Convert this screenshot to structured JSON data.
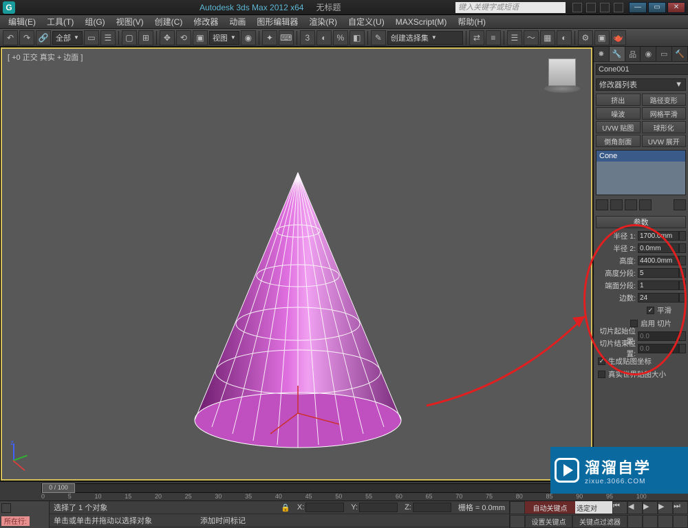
{
  "titlebar": {
    "app": "Autodesk 3ds Max 2012 x64",
    "doc": "无标题",
    "search_placeholder": "键入关键字或短语"
  },
  "menus": [
    "编辑(E)",
    "工具(T)",
    "组(G)",
    "视图(V)",
    "创建(C)",
    "修改器",
    "动画",
    "图形编辑器",
    "渲染(R)",
    "自定义(U)",
    "MAXScript(M)",
    "帮助(H)"
  ],
  "toolbar": {
    "set_dropdown": "全部",
    "view_dropdown": "视图",
    "selset_dropdown": "创建选择集"
  },
  "viewport": {
    "label": "[ +0 正交 真实 + 边面 ]"
  },
  "panel": {
    "object_name": "Cone001",
    "modlist": "修改器列表",
    "mod_buttons": [
      "挤出",
      "路径变形",
      "噪波",
      "网格平滑",
      "UVW 贴图",
      "球形化",
      "倒角剖面",
      "UVW 展开"
    ],
    "stack_item": "Cone",
    "rollout_title": "参数",
    "params": [
      {
        "label": "半径 1:",
        "value": "1700.0mm"
      },
      {
        "label": "半径 2:",
        "value": "0.0mm"
      },
      {
        "label": "高度:",
        "value": "4400.0mm"
      },
      {
        "label": "高度分段:",
        "value": "5"
      },
      {
        "label": "端面分段:",
        "value": "1"
      },
      {
        "label": "边数:",
        "value": "24"
      }
    ],
    "smooth": "平滑",
    "enable_slice": "启用 切片",
    "slice_from": {
      "label": "切片起始位置:",
      "value": "0.0"
    },
    "slice_to": {
      "label": "切片结束位置:",
      "value": "0.0"
    },
    "gen_map": "生成贴图坐标",
    "real_world": "真实世界贴图大小"
  },
  "time": {
    "slider": "0 / 100",
    "ticks": [
      "0",
      "5",
      "10",
      "15",
      "20",
      "25",
      "30",
      "35",
      "40",
      "45",
      "50",
      "55",
      "60",
      "65",
      "70",
      "75",
      "80",
      "85",
      "90",
      "95",
      "100"
    ]
  },
  "status": {
    "here": "所在行:",
    "selected": "选择了 1 个对象",
    "hint": "单击或单击并拖动以选择对象",
    "addkey": "添加时间标记",
    "x": "X:",
    "y": "Y:",
    "z": "Z:",
    "grid": "栅格 = 0.0mm",
    "autokey": "自动关键点",
    "selfilter": "选定对",
    "setkey": "设置关键点",
    "keyfilter": "关键点过滤器"
  },
  "watermark": {
    "big": "溜溜自学",
    "small": "zixue.3066.COM"
  }
}
